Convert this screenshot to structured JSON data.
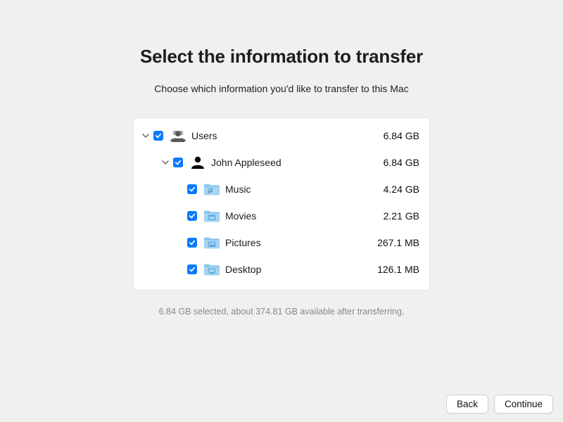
{
  "header": {
    "title": "Select the information to transfer",
    "subtitle": "Choose which information you'd like to transfer to this Mac"
  },
  "tree": {
    "users": {
      "label": "Users",
      "size": "6.84 GB",
      "user": {
        "label": "John Appleseed",
        "size": "6.84 GB",
        "items": [
          {
            "label": "Music",
            "size": "4.24 GB",
            "icon": "music-folder"
          },
          {
            "label": "Movies",
            "size": "2.21 GB",
            "icon": "movies-folder"
          },
          {
            "label": "Pictures",
            "size": "267.1 MB",
            "icon": "pictures-folder"
          },
          {
            "label": "Desktop",
            "size": "126.1 MB",
            "icon": "desktop-folder"
          }
        ]
      }
    }
  },
  "status": "6.84 GB selected, about 374.81 GB available after transferring.",
  "footer": {
    "back": "Back",
    "continue": "Continue"
  },
  "colors": {
    "accent": "#0a7aff",
    "folder_top": "#9ecff6",
    "folder_body": "#82c4f3"
  }
}
